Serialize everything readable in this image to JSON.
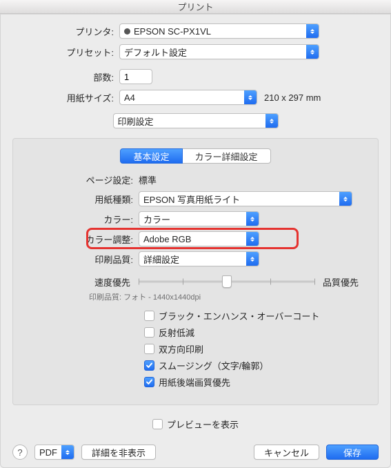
{
  "window": {
    "title": "プリント"
  },
  "top": {
    "printer_label": "プリンタ:",
    "printer_value": "EPSON SC-PX1VL",
    "preset_label": "プリセット:",
    "preset_value": "デフォルト設定",
    "copies_label": "部数:",
    "copies_value": "1",
    "papersize_label": "用紙サイズ:",
    "papersize_value": "A4",
    "papersize_dims": "210 x 297 mm",
    "section_value": "印刷設定"
  },
  "tabs": {
    "basic": "基本設定",
    "advanced": "カラー詳細設定"
  },
  "panel": {
    "page_setup_label": "ページ設定:",
    "page_setup_value": "標準",
    "media_label": "用紙種類:",
    "media_value": "EPSON 写真用紙ライト",
    "color_label": "カラー:",
    "color_value": "カラー",
    "color_adjust_label": "カラー調整:",
    "color_adjust_value": "Adobe RGB",
    "quality_label": "印刷品質:",
    "quality_value": "詳細設定",
    "slider_left": "速度優先",
    "slider_right": "品質優先",
    "quality_note": "印刷品質: フォト - 1440x1440dpi",
    "checks": [
      {
        "label": "ブラック・エンハンス・オーバーコート",
        "checked": false
      },
      {
        "label": "反射低減",
        "checked": false
      },
      {
        "label": "双方向印刷",
        "checked": false
      },
      {
        "label": "スムージング（文字/輪郭）",
        "checked": true
      },
      {
        "label": "用紙後端画質優先",
        "checked": true
      }
    ]
  },
  "preview": {
    "label": "プレビューを表示",
    "checked": false
  },
  "footer": {
    "help": "?",
    "pdf": "PDF",
    "details": "詳細を非表示",
    "cancel": "キャンセル",
    "save": "保存"
  }
}
